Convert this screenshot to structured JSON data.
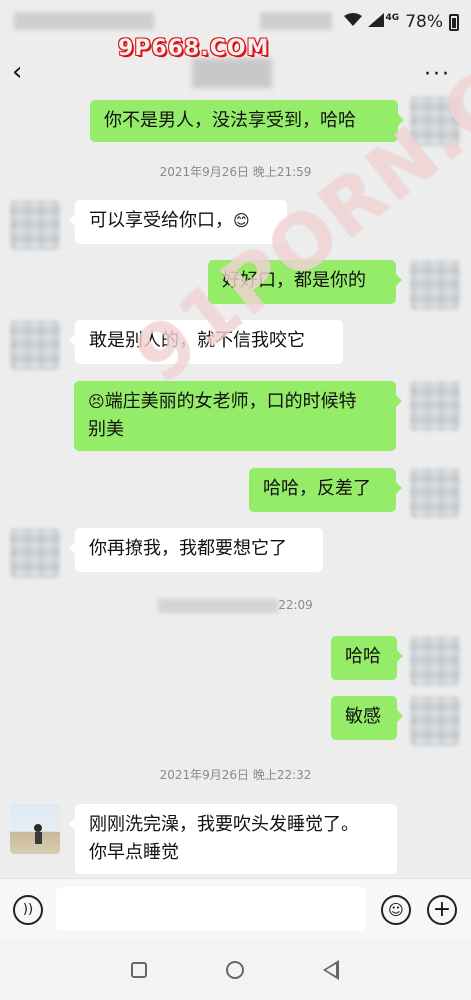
{
  "status_bar": {
    "battery": "78%",
    "network": "4G"
  },
  "watermarks": {
    "top": "9P668.COM",
    "diagonal": "91PORN.COM"
  },
  "header": {
    "back": "‹",
    "more": "···"
  },
  "messages": [
    {
      "side": "right",
      "text": "你不是男人，没法享受到，哈哈"
    },
    {
      "time": "2021年9月26日 晚上21:59"
    },
    {
      "side": "left",
      "text": "可以享受给你口，",
      "emoji": "😊"
    },
    {
      "side": "right",
      "text": "好好口，都是你的"
    },
    {
      "side": "left",
      "text": "敢是别人的，就不信我咬它"
    },
    {
      "side": "right",
      "emoji": "😣",
      "text_line1": "端庄美丽的女老师，口的时候特",
      "text_line2": "别美"
    },
    {
      "side": "right",
      "text": "哈哈，反差了"
    },
    {
      "side": "left",
      "text": "你再撩我，我都要想它了"
    },
    {
      "time_suffix": "22:09"
    },
    {
      "side": "right",
      "text": "哈哈"
    },
    {
      "side": "right",
      "text": "敏感"
    },
    {
      "time": "2021年9月26日 晚上22:32"
    },
    {
      "side": "left",
      "text_line1": "刚刚洗完澡，我要吹头发睡觉了。",
      "text_line2": "你早点睡觉"
    }
  ],
  "input_bar": {
    "voice_icon": "voice-icon",
    "emoji_icon": "emoji-icon",
    "plus_icon": "plus-icon"
  },
  "colors": {
    "background": "#ededed",
    "bubble_sent": "#95ec69",
    "bubble_received": "#ffffff"
  }
}
